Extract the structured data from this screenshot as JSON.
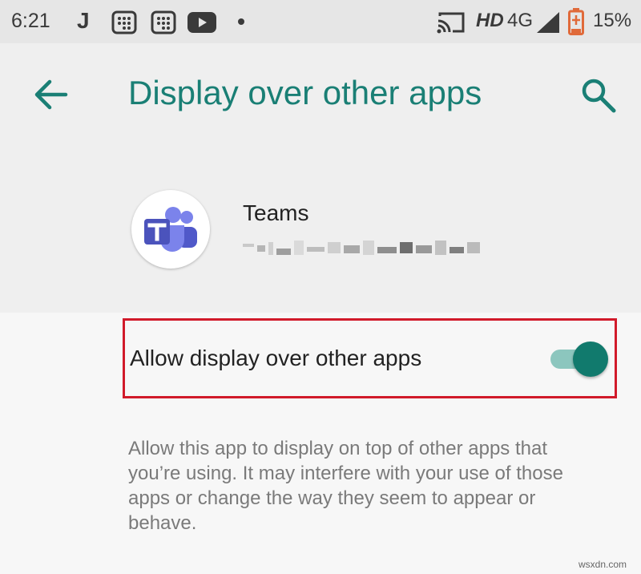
{
  "status_bar": {
    "time": "6:21",
    "j_label": "J",
    "network_label": "HD",
    "network_type": "4G",
    "battery_percent": "15%",
    "icons": [
      "grid-icon",
      "grid-icon",
      "youtube-icon",
      "dot-icon",
      "cast-icon",
      "signal-icon",
      "battery-icon"
    ]
  },
  "toolbar": {
    "title": "Display over other apps"
  },
  "app": {
    "name": "Teams"
  },
  "setting": {
    "label": "Allow display over other apps",
    "enabled": true,
    "description": "Allow this app to display on top of other apps that you’re using. It may interfere with your use of those apps or change the way they seem to appear or behave."
  },
  "watermark": "wsxdn.com",
  "colors": {
    "accent": "#1a7f75",
    "toggle_thumb": "#117a6d",
    "toggle_track": "#8cc6be",
    "highlight": "#d11a2a"
  }
}
